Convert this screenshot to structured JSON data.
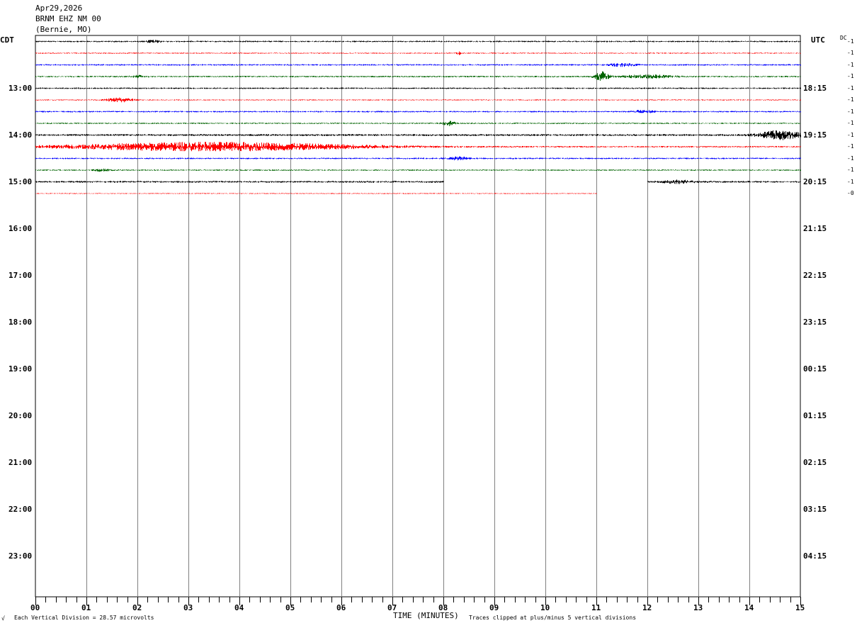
{
  "header": {
    "date": "Apr29,2026",
    "station": "BRNM EHZ NM 00",
    "location": "(Bernie, MO)"
  },
  "left_zone_label": "CDT",
  "right_zone_label": "UTC",
  "dc_label": "DC",
  "footer": {
    "mark": "√",
    "division_note": "Each Vertical Division =   28.57 microvolts",
    "clip_note": "Traces clipped at plus/minus 5 vertical divisions"
  },
  "colors": {
    "trace_cycle": [
      "#000000",
      "#ff0000",
      "#0000ff",
      "#006400"
    ],
    "grid": "#808080"
  },
  "chart_data": {
    "type": "line",
    "title": "",
    "xlabel": "TIME (MINUTES)",
    "ylabel": "",
    "xlim": [
      0,
      15
    ],
    "x_ticks": [
      "00",
      "01",
      "02",
      "03",
      "04",
      "05",
      "06",
      "07",
      "08",
      "09",
      "10",
      "11",
      "12",
      "13",
      "14",
      "15"
    ],
    "left_hour_labels": [
      "13:00",
      "14:00",
      "15:00",
      "16:00",
      "17:00",
      "18:00",
      "19:00",
      "20:00",
      "21:00",
      "22:00",
      "23:00"
    ],
    "right_hour_labels": [
      "18:15",
      "19:15",
      "20:15",
      "21:15",
      "22:15",
      "23:15",
      "00:15",
      "01:15",
      "02:15",
      "03:15",
      "04:15"
    ],
    "lines_per_hour": 4,
    "total_line_slots": 48,
    "traces": [
      {
        "dc": "-1",
        "segments": [
          [
            0,
            15
          ]
        ],
        "noise": 1.0,
        "events": [
          {
            "t": 2.3,
            "amp": 1.5,
            "dur": 0.3
          }
        ]
      },
      {
        "dc": "-1",
        "segments": [
          [
            0,
            15
          ]
        ],
        "noise": 0.7,
        "events": [
          {
            "t": 8.3,
            "amp": 2,
            "dur": 0.1
          }
        ]
      },
      {
        "dc": "-1",
        "segments": [
          [
            0,
            15
          ]
        ],
        "noise": 1.0,
        "events": [
          {
            "t": 11.5,
            "amp": 2,
            "dur": 0.5
          }
        ]
      },
      {
        "dc": "-1",
        "segments": [
          [
            0,
            15
          ]
        ],
        "noise": 1.0,
        "events": [
          {
            "t": 2.0,
            "amp": 1.5,
            "dur": 0.3
          },
          {
            "t": 11.1,
            "amp": 7,
            "dur": 0.25
          },
          {
            "t": 12.0,
            "amp": 2,
            "dur": 1.0
          }
        ]
      },
      {
        "dc": "-1",
        "segments": [
          [
            0,
            15
          ]
        ],
        "noise": 1.0,
        "events": []
      },
      {
        "dc": "-1",
        "segments": [
          [
            0,
            15
          ]
        ],
        "noise": 0.7,
        "events": [
          {
            "t": 1.65,
            "amp": 3,
            "dur": 0.5
          }
        ]
      },
      {
        "dc": "-1",
        "segments": [
          [
            0,
            15
          ]
        ],
        "noise": 1.0,
        "events": [
          {
            "t": 11.9,
            "amp": 2,
            "dur": 0.4
          }
        ]
      },
      {
        "dc": "-1",
        "segments": [
          [
            0,
            15
          ]
        ],
        "noise": 0.9,
        "events": [
          {
            "t": 8.1,
            "amp": 3,
            "dur": 0.25
          }
        ]
      },
      {
        "dc": "-1",
        "segments": [
          [
            0,
            15
          ]
        ],
        "noise": 1.3,
        "events": [
          {
            "t": 14.6,
            "amp": 6,
            "dur": 0.8
          }
        ]
      },
      {
        "dc": "-1",
        "segments": [
          [
            0,
            15
          ]
        ],
        "noise": 1.0,
        "events": [
          {
            "t": 3.5,
            "amp": 6,
            "dur": 5.5
          }
        ]
      },
      {
        "dc": "-1",
        "segments": [
          [
            0,
            15
          ]
        ],
        "noise": 1.0,
        "events": [
          {
            "t": 8.3,
            "amp": 2,
            "dur": 0.4
          }
        ]
      },
      {
        "dc": "-1",
        "segments": [
          [
            0,
            15
          ]
        ],
        "noise": 0.9,
        "events": [
          {
            "t": 1.3,
            "amp": 1.5,
            "dur": 0.3
          }
        ]
      },
      {
        "dc": "-1",
        "segments": [
          [
            0,
            8.0
          ],
          [
            12.0,
            15
          ]
        ],
        "noise": 1.2,
        "events": [
          {
            "t": 12.6,
            "amp": 2,
            "dur": 0.6
          }
        ]
      },
      {
        "dc": "-0",
        "segments": [
          [
            0,
            11.0
          ]
        ],
        "noise": 0.6,
        "events": []
      }
    ]
  }
}
